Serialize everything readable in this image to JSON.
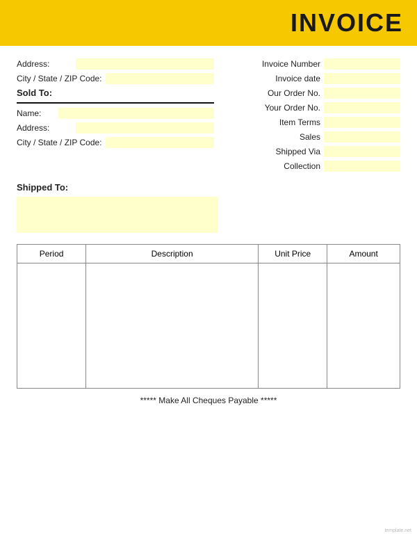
{
  "header": {
    "title": "INVOICE"
  },
  "left_section": {
    "address_label": "Address:",
    "city_label": "City / State / ZIP Code:"
  },
  "sold_to": {
    "label": "Sold To:",
    "name_label": "Name:",
    "address_label": "Address:",
    "city_label": "City / State / ZIP Code:"
  },
  "right_section": {
    "fields": [
      {
        "label": "Invoice Number"
      },
      {
        "label": "Invoice date"
      },
      {
        "label": "Our Order No."
      },
      {
        "label": "Your Order No."
      },
      {
        "label": "Item Terms"
      },
      {
        "label": "Sales"
      },
      {
        "label": "Shipped Via"
      },
      {
        "label": "Collection"
      }
    ]
  },
  "shipped_to": {
    "label": "Shipped To:"
  },
  "table": {
    "columns": [
      "Period",
      "Description",
      "Unit Price",
      "Amount"
    ]
  },
  "footer": {
    "text": "***** Make All Cheques Payable *****"
  },
  "watermark": "template.net"
}
